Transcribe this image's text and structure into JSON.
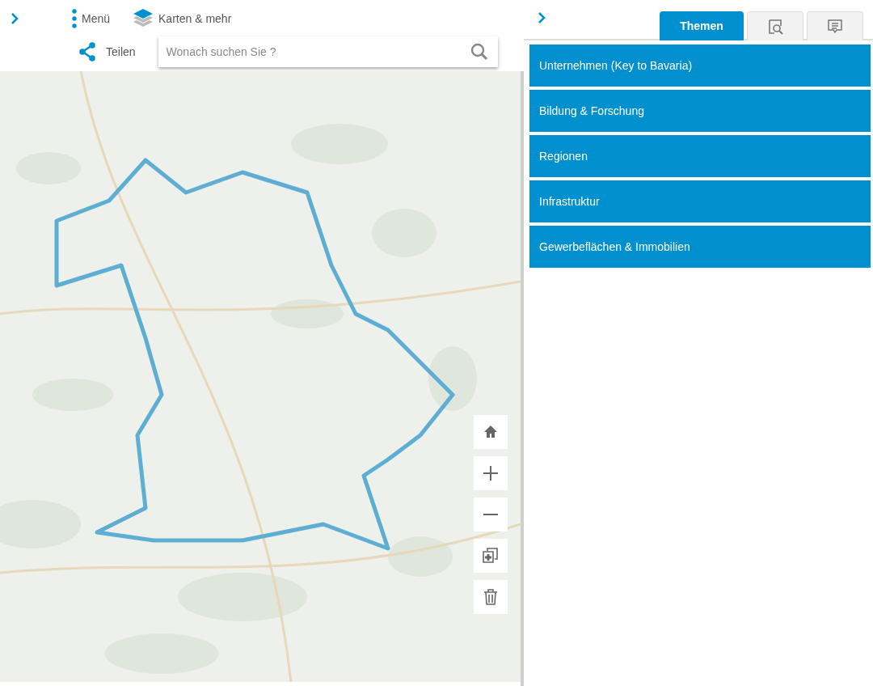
{
  "toolbar": {
    "menu": {
      "label": "Menü"
    },
    "layers": {
      "label": "Karten & mehr"
    },
    "share": {
      "label": "Teilen"
    },
    "search": {
      "placeholder": "Wonach suchen Sie ?"
    }
  },
  "map_controls": [
    {
      "kind": "home"
    },
    {
      "kind": "zoom-in"
    },
    {
      "kind": "zoom-out"
    },
    {
      "kind": "add-frame"
    },
    {
      "kind": "trash"
    }
  ],
  "side_panel": {
    "tabs": [
      {
        "kind": "text",
        "label": "Themen",
        "selected": true
      },
      {
        "kind": "search",
        "selected": false
      },
      {
        "kind": "comment",
        "selected": false
      }
    ],
    "themes": [
      {
        "label": "Unternehmen (Key to Bavaria)"
      },
      {
        "label": "Bildung & Forschung"
      },
      {
        "label": "Regionen"
      },
      {
        "label": "Infrastruktur"
      },
      {
        "label": "Gewerbeflächen & Immobilien"
      }
    ]
  }
}
